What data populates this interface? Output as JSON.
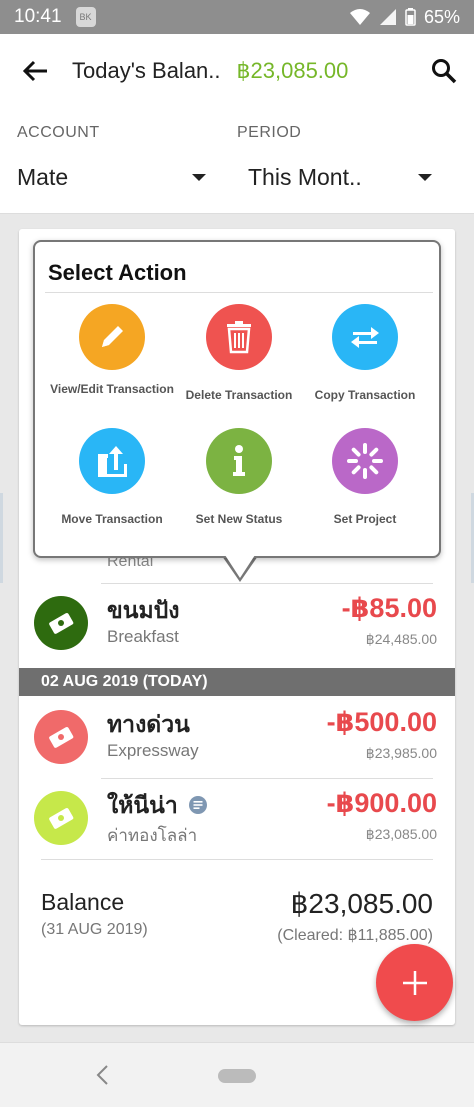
{
  "status_bar": {
    "time": "10:41",
    "battery": "65%"
  },
  "app_bar": {
    "title": "Today's Balan..",
    "amount": "฿23,085.00"
  },
  "filters": {
    "account_label": "ACCOUNT",
    "account_value": "Mate",
    "period_label": "PERIOD",
    "period_value": "This Mont.."
  },
  "popup": {
    "title": "Select Action",
    "actions": [
      {
        "label": "View/Edit Transaction",
        "color": "#f5a623",
        "icon": "pencil-icon"
      },
      {
        "label": "Delete Transaction",
        "color": "#ef5350",
        "icon": "trash-icon"
      },
      {
        "label": "Copy Transaction",
        "color": "#29b6f6",
        "icon": "swap-arrows-icon"
      },
      {
        "label": "Move Transaction",
        "color": "#29b6f6",
        "icon": "export-icon"
      },
      {
        "label": "Set New Status",
        "color": "#7cb342",
        "icon": "info-icon"
      },
      {
        "label": "Set Project",
        "color": "#ba68c8",
        "icon": "spinner-icon"
      }
    ]
  },
  "transactions_partial": {
    "category": "Rental"
  },
  "transactions": [
    {
      "name": "ขนมปัง",
      "category": "Breakfast",
      "amount": "-฿85.00",
      "balance": "฿24,485.00",
      "avatar_color": "#2e6b0f"
    },
    {
      "name": "ทางด่วน",
      "category": "Expressway",
      "amount": "-฿500.00",
      "balance": "฿23,985.00",
      "avatar_color": "#f06a6a"
    },
    {
      "name": "ให้นีน่า",
      "category": "ค่าทองโลล่า",
      "amount": "-฿900.00",
      "balance": "฿23,085.00",
      "avatar_color": "#c6e84a"
    }
  ],
  "date_header": "02 AUG 2019 (TODAY)",
  "balance": {
    "label": "Balance",
    "date": "(31 AUG 2019)",
    "amount": "฿23,085.00",
    "cleared": "(Cleared: ฿11,885.00)"
  }
}
